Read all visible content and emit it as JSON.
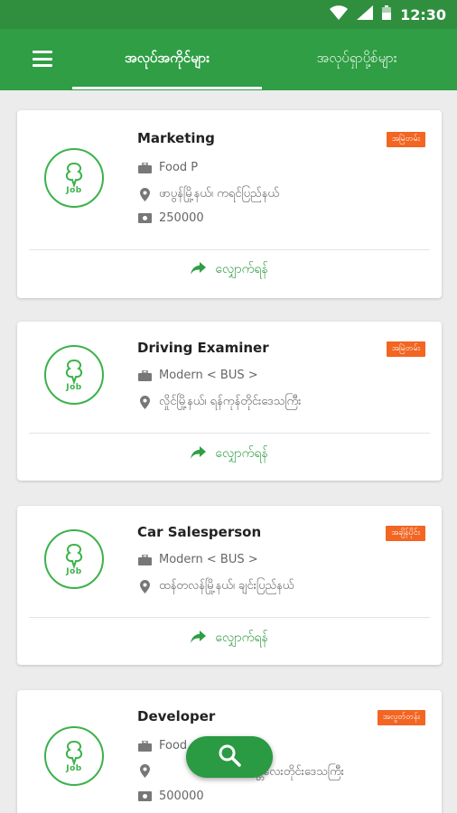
{
  "status_bar": {
    "time": "12:30"
  },
  "app_bar": {
    "tabs": [
      {
        "label": "အလုပ်အကိုင်များ",
        "active": true
      },
      {
        "label": "အလုပ်ရှာပို့စ်များ",
        "active": false
      }
    ]
  },
  "jobs": [
    {
      "title": "Marketing",
      "badge": "အမြဲတမ်း",
      "company": "Food P",
      "location": "ဖာပွန်မြို့နယ်၊ ကရင်ပြည်နယ်",
      "salary": "250000",
      "apply_label": "လျှောက်ရန်"
    },
    {
      "title": "Driving Examiner",
      "badge": "အမြဲတမ်း",
      "company": "Modern < BUS >",
      "location": "လှိုင်မြို့နယ်၊ ရန်ကုန်တိုင်းဒေသကြီး",
      "apply_label": "လျှောက်ရန်"
    },
    {
      "title": "Car Salesperson",
      "badge": "အချိန်ပိုင်း",
      "company": "Modern < BUS >",
      "location": "ထန်တလန်မြို့နယ်၊ ချင်းပြည်နယ်",
      "apply_label": "လျှောက်ရန်"
    },
    {
      "title": "Developer",
      "badge": "အလွတ်တန်း",
      "company": "Food",
      "location": "မန္တလေးတိုင်းဒေသကြီး",
      "salary": "500000"
    }
  ],
  "logo_text": "Job",
  "colors": {
    "primary": "#2f9e44",
    "status_bar": "#2f8f3f",
    "badge": "#f26522",
    "background": "#ececec"
  }
}
